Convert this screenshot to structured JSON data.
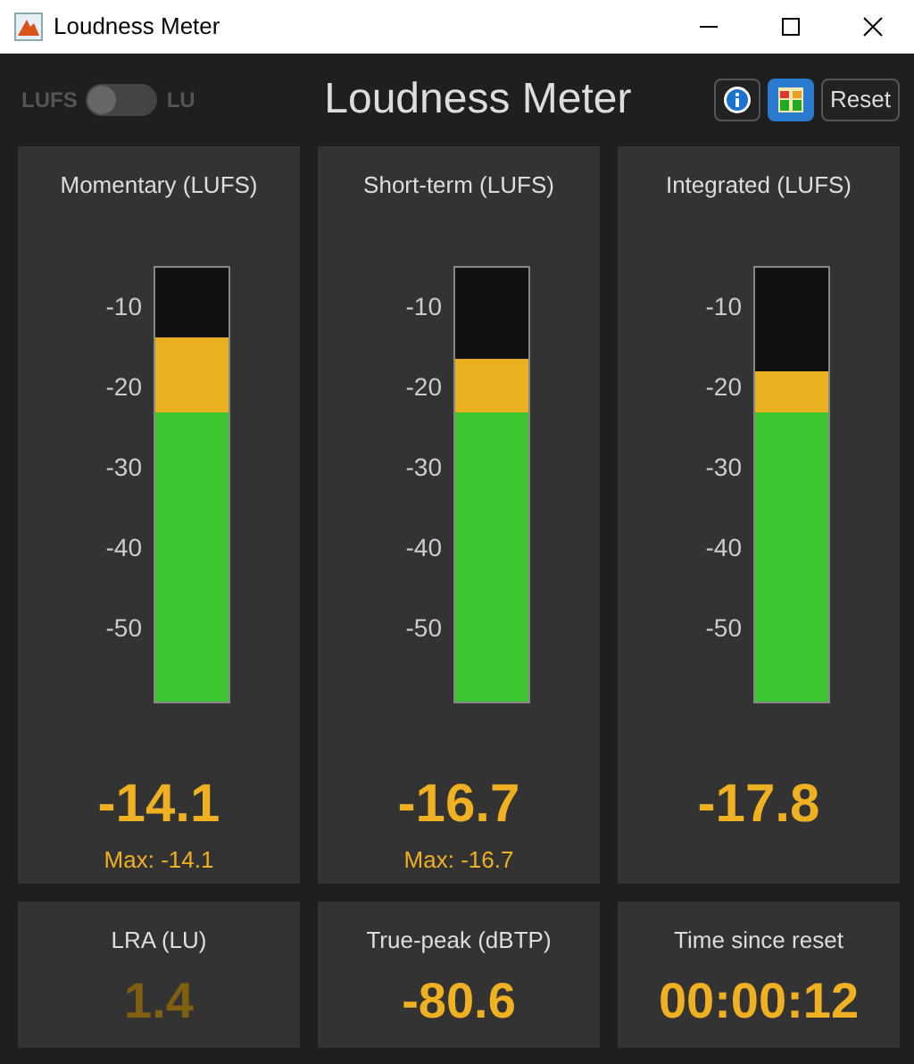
{
  "window": {
    "title": "Loudness Meter"
  },
  "header": {
    "toggle": {
      "left_label": "LUFS",
      "right_label": "LU",
      "on": false
    },
    "title": "Loudness Meter",
    "buttons": [
      {
        "kind": "info",
        "selected": false
      },
      {
        "kind": "colors",
        "selected": true
      },
      {
        "kind": "text",
        "label": "Reset",
        "selected": false
      }
    ]
  },
  "scale": {
    "target": {
      "level": 0.665
    }
  },
  "meters": [
    {
      "title": "Momentary (LUFS)",
      "ticks": [
        "-10",
        "-20",
        "-30",
        "-40",
        "-50"
      ],
      "level": 0.837,
      "reading": "-14.1",
      "max": "Max: -14.1"
    },
    {
      "title": "Short-term (LUFS)",
      "ticks": [
        "-10",
        "-20",
        "-30",
        "-40",
        "-50"
      ],
      "level": 0.788,
      "reading": "-16.7",
      "max": "Max: -16.7"
    },
    {
      "title": "Integrated (LUFS)",
      "ticks": [
        "-10",
        "-20",
        "-30",
        "-40",
        "-50"
      ],
      "level": 0.759,
      "reading": "-17.8"
    }
  ],
  "stats": [
    {
      "title": "LRA (LU)",
      "value": "1.4",
      "dimmed": true
    },
    {
      "title": "True-peak (dBTP)",
      "value": "-80.6",
      "dimmed": false
    },
    {
      "title": "Time since reset",
      "value": "00:00:12",
      "dimmed": false
    }
  ]
}
